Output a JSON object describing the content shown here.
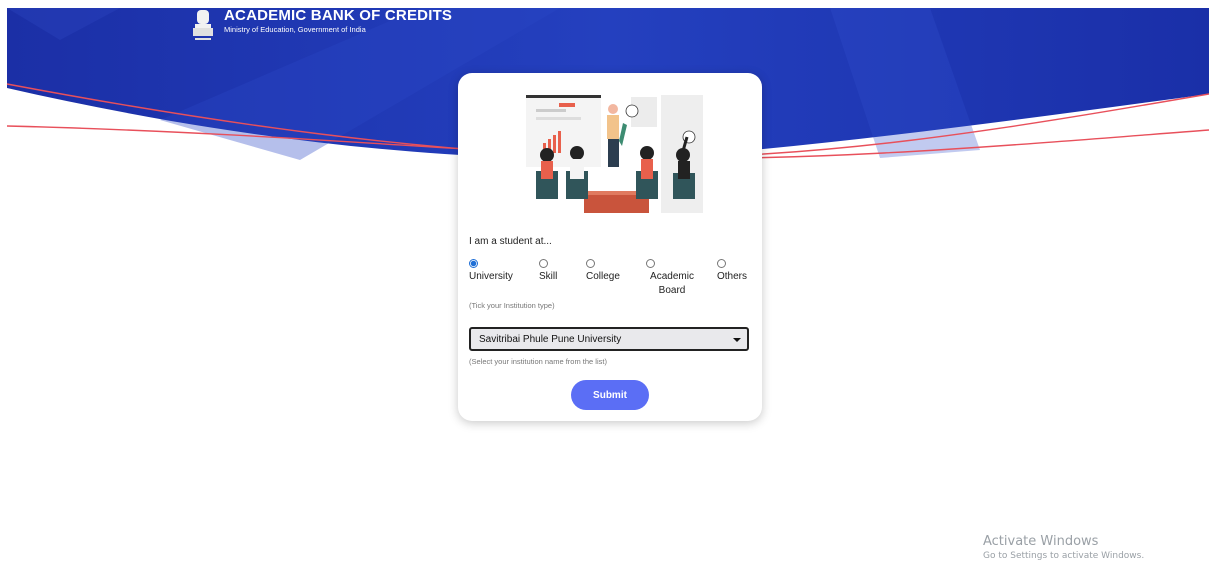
{
  "header": {
    "title": "ACADEMIC BANK OF CREDITS",
    "subtitle": "Ministry of Education, Government of India",
    "emblem_icon": "national-emblem-icon"
  },
  "form": {
    "illustration": "classroom-presentation-illustration",
    "question": "I am a student at...",
    "institution_types": [
      {
        "label": "University",
        "selected": true
      },
      {
        "label": "Skill",
        "selected": false
      },
      {
        "label": "College",
        "selected": false
      },
      {
        "label": "Academic Board",
        "selected": false
      },
      {
        "label": "Others",
        "selected": false
      }
    ],
    "type_hint": "(Tick your Institution type)",
    "institution_select": {
      "value": "Savitribai Phule Pune University"
    },
    "institution_hint": "(Select your institution name from the list)",
    "submit_label": "Submit"
  },
  "overlay": {
    "title": "Activate Windows",
    "subtitle": "Go to Settings to activate Windows."
  },
  "colors": {
    "banner_blue": "#1e35b4",
    "accent_red": "#e8505b",
    "submit_blue": "#5b6ef5"
  }
}
